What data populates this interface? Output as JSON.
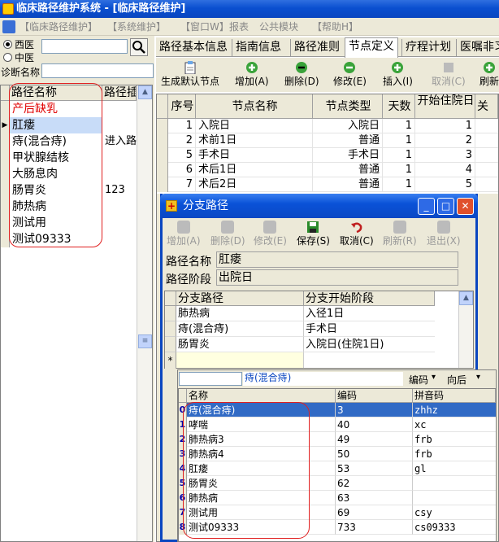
{
  "title": "临床路径维护系统  -  [临床路径维护]",
  "menu": [
    "【临床路径维护】",
    "【系统维护】",
    "【窗口W】",
    "报表",
    "公共模块",
    "【帮助H】"
  ],
  "left": {
    "radio_west": "西医",
    "radio_chinese": "中医",
    "diag_label": "诊断名称",
    "col_name": "路径名称",
    "col_step": "路径插",
    "rows": [
      {
        "name": "产后缺乳",
        "step": "",
        "red": true
      },
      {
        "name": "肛瘘",
        "step": "",
        "selected": true
      },
      {
        "name": "痔(混合痔)",
        "step": "进入路"
      },
      {
        "name": "甲状腺结核",
        "step": ""
      },
      {
        "name": "大肠息肉",
        "step": ""
      },
      {
        "name": "肠胃炎",
        "step": "123"
      },
      {
        "name": "肺热病",
        "step": ""
      },
      {
        "name": "测试用",
        "step": ""
      },
      {
        "name": "测试09333",
        "step": ""
      }
    ]
  },
  "tabs": [
    "路径基本信息",
    "指南信息",
    "路径准则",
    "节点定义",
    "疗程计划",
    "医嘱非习"
  ],
  "toolbar": [
    {
      "label": "生成默认节点",
      "disabled": false
    },
    {
      "label": "增加(A)",
      "disabled": false
    },
    {
      "label": "删除(D)",
      "disabled": false
    },
    {
      "label": "修改(E)",
      "disabled": false
    },
    {
      "label": "插入(I)",
      "disabled": false
    },
    {
      "label": "取消(C)",
      "disabled": true
    },
    {
      "label": "刷新",
      "disabled": false
    }
  ],
  "node_table": {
    "headers": [
      "序号",
      "节点名称",
      "节点类型",
      "天数",
      "开始住院日",
      "关"
    ],
    "rows": [
      {
        "seq": "1",
        "name": "入院日",
        "type": "入院日",
        "days": "1",
        "start": "1"
      },
      {
        "seq": "2",
        "name": "术前1日",
        "type": "普通",
        "days": "1",
        "start": "2"
      },
      {
        "seq": "5",
        "name": "手术日",
        "type": "手术日",
        "days": "1",
        "start": "3"
      },
      {
        "seq": "6",
        "name": "术后1日",
        "type": "普通",
        "days": "1",
        "start": "4"
      },
      {
        "seq": "7",
        "name": "术后2日",
        "type": "普通",
        "days": "1",
        "start": "5"
      }
    ]
  },
  "dialog": {
    "title": "分支路径",
    "toolbar": [
      {
        "label": "增加(A)",
        "disabled": true
      },
      {
        "label": "删除(D)",
        "disabled": true
      },
      {
        "label": "修改(E)",
        "disabled": true
      },
      {
        "label": "保存(S)",
        "disabled": false
      },
      {
        "label": "取消(C)",
        "disabled": false
      },
      {
        "label": "刷新(R)",
        "disabled": true
      },
      {
        "label": "退出(X)",
        "disabled": true
      }
    ],
    "path_name_label": "路径名称",
    "path_name_value": "肛瘘",
    "path_stage_label": "路径阶段",
    "path_stage_value": "出院日",
    "branch_headers": [
      "分支路径",
      "分支开始阶段"
    ],
    "branch_rows": [
      {
        "path": "肺热病",
        "stage": "入径1日"
      },
      {
        "path": "痔(混合痔)",
        "stage": "手术日"
      },
      {
        "path": "肠胃炎",
        "stage": "入院日(住院1日)"
      }
    ],
    "new_row_marker": "*",
    "search_value": "痔(混合痔)",
    "sort_field": "编码",
    "sort_dir": "向后",
    "lookup_headers": [
      "名称",
      "编码",
      "拼音码"
    ],
    "lookup_rows": [
      {
        "mark": "0",
        "name": "痔(混合痔)",
        "code": "3",
        "py": "zhhz",
        "selected": true
      },
      {
        "mark": "1",
        "name": "哮喘",
        "code": "40",
        "py": "xc"
      },
      {
        "mark": "2",
        "name": "肺热病3",
        "code": "49",
        "py": "frb"
      },
      {
        "mark": "3",
        "name": "肺热病4",
        "code": "50",
        "py": "frb"
      },
      {
        "mark": "4",
        "name": "肛瘘",
        "code": "53",
        "py": "gl"
      },
      {
        "mark": "5",
        "name": "肠胃炎",
        "code": "62",
        "py": ""
      },
      {
        "mark": "6",
        "name": "肺热病",
        "code": "63",
        "py": ""
      },
      {
        "mark": "7",
        "name": "测试用",
        "code": "69",
        "py": "csy"
      },
      {
        "mark": "8",
        "name": "测试09333",
        "code": "733",
        "py": "cs09333"
      }
    ]
  },
  "colors": {
    "accent": "#0a46c0",
    "highlight": "#316ac5",
    "red": "#e00000",
    "annotation": "#e02020"
  }
}
